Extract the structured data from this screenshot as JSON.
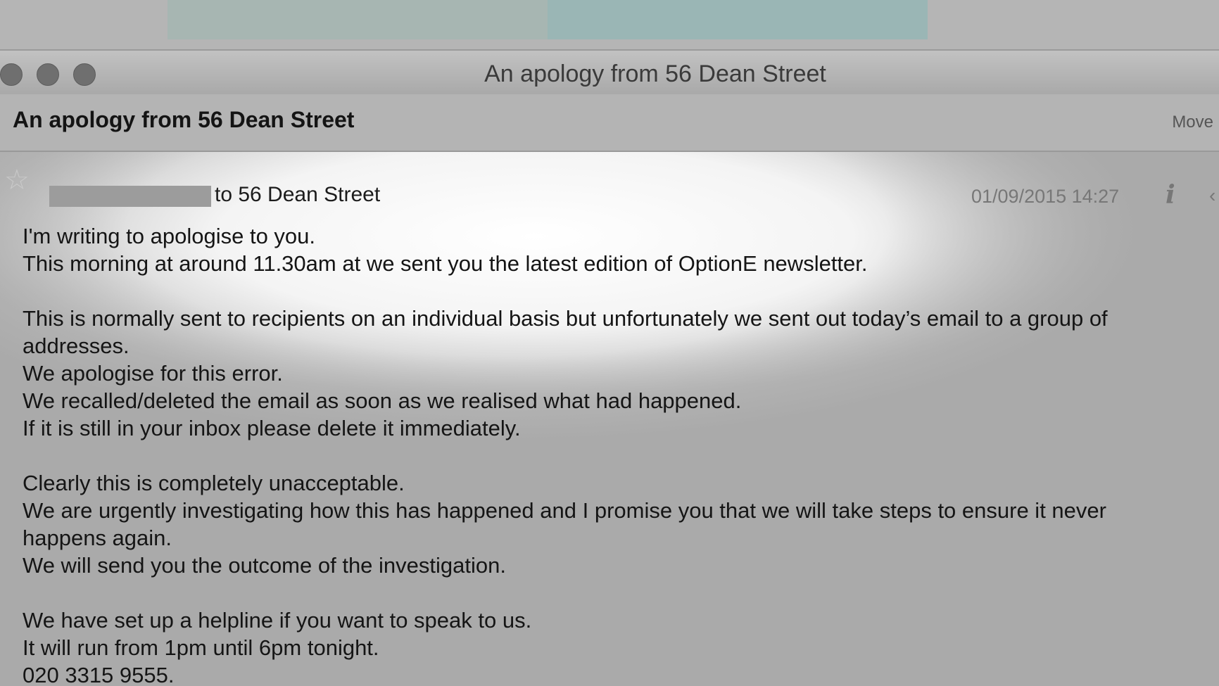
{
  "window": {
    "title": "An apology from 56 Dean Street"
  },
  "toolbar": {
    "subject": "An apology from 56 Dean Street",
    "move_label": "Move"
  },
  "message": {
    "recipient_text": "to 56 Dean Street",
    "date": "01/09/2015 14:27",
    "info_icon": "i",
    "paragraphs": [
      [
        "I'm writing to apologise to you.",
        "This morning at around 11.30am at  we sent you the latest edition of OptionE newsletter."
      ],
      [
        "This is normally sent to recipients on an individual basis but unfortunately we sent out today’s email  to a group of",
        "addresses.",
        "We apologise for this error.",
        "We recalled/deleted the email as soon as we realised what had happened.",
        "If it is still in your inbox please delete it immediately."
      ],
      [
        "Clearly this is completely unacceptable.",
        "We are urgently investigating how this has happened and I promise you that we will take steps to ensure it never",
        "happens again.",
        "We will send you the outcome of the investigation."
      ],
      [
        "We have set up a helpline if you want to speak to us.",
        "It will run from 1pm  until 6pm tonight.",
        "020 3315 9555."
      ]
    ]
  }
}
